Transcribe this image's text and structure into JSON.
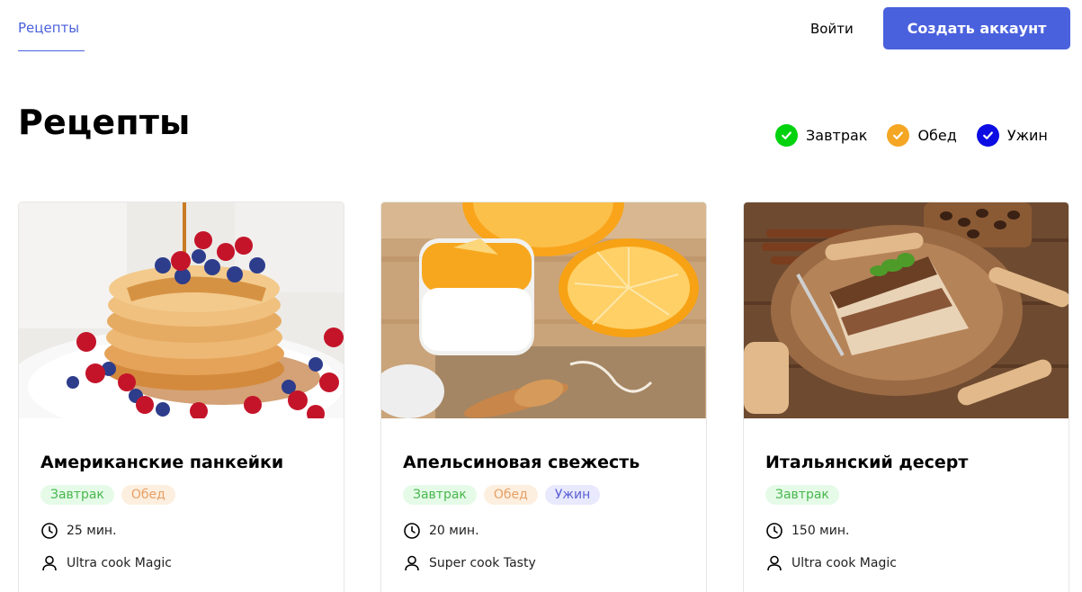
{
  "header": {
    "nav_recipes": "Рецепты",
    "login": "Войти",
    "signup": "Создать аккаунт"
  },
  "page": {
    "title": "Рецепты"
  },
  "filters": [
    {
      "label": "Завтрак",
      "color": "#00d20e"
    },
    {
      "label": "Обед",
      "color": "#f5a623"
    },
    {
      "label": "Ужин",
      "color": "#0c0ce3"
    }
  ],
  "cards": [
    {
      "title": "Американские панкейки",
      "tags": [
        "Завтрак",
        "Обед"
      ],
      "time": "25 мин.",
      "author": "Ultra cook Magic"
    },
    {
      "title": "Апельсиновая свежесть",
      "tags": [
        "Завтрак",
        "Обед",
        "Ужин"
      ],
      "time": "20 мин.",
      "author": "Super cook Tasty"
    },
    {
      "title": "Итальянский десерт",
      "tags": [
        "Завтрак"
      ],
      "time": "150 мин.",
      "author": "Ultra cook Magic"
    }
  ]
}
